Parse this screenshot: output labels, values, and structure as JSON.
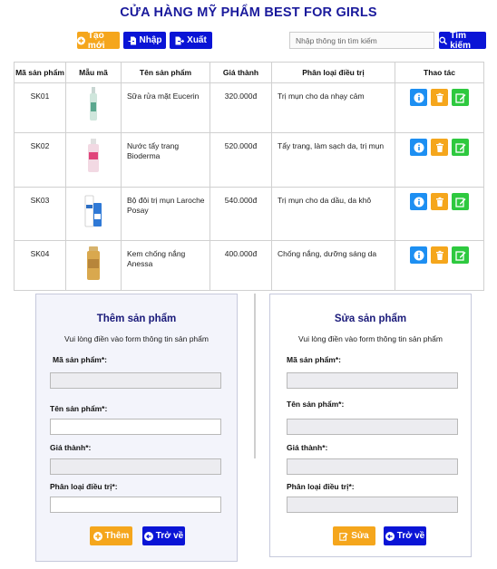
{
  "header": {
    "title": "CỬA HÀNG MỸ PHẨM BEST FOR GIRLS"
  },
  "toolbar": {
    "create_label": "Tạo mới",
    "import_label": "Nhập",
    "export_label": "Xuất",
    "search_placeholder": "Nhập thông tin tìm kiếm",
    "search_label": "Tìm kiếm"
  },
  "table": {
    "headers": [
      "Mã sản phẩm",
      "Mẫu mã",
      "Tên sản phẩm",
      "Giá thành",
      "Phân loại điều trị",
      "Thao tác"
    ],
    "rows": [
      {
        "code": "SK01",
        "name": "Sữa rửa mặt Eucerin",
        "price": "320.000đ",
        "type": "Trị mụn cho da nhạy cảm"
      },
      {
        "code": "SK02",
        "name": "Nước tẩy trang Bioderma",
        "price": "520.000đ",
        "type": "Tẩy trang, làm sạch da, trị mụn"
      },
      {
        "code": "SK03",
        "name": "Bộ đôi trị mụn Laroche Posay",
        "price": "540.000đ",
        "type": "Trị mụn cho da dầu, da khô"
      },
      {
        "code": "SK04",
        "name": "Kem chống nắng Anessa",
        "price": "400.000đ",
        "type": "Chống nắng, dưỡng sáng da"
      }
    ]
  },
  "add_form": {
    "title": "Thêm sản phẩm",
    "subtitle": "Vui lòng điền vào form thông tin sản phẩm",
    "code_label": "Mã sản phẩm*:",
    "name_label": "Tên sản phẩm*:",
    "price_label": "Giá thành*:",
    "type_label": "Phân loại điều trị*:",
    "submit_label": "Thêm",
    "back_label": "Trở về"
  },
  "edit_form": {
    "title": "Sửa sản phẩm",
    "subtitle": "Vui lòng điền vào form thông tin sản phẩm",
    "code_label": "Mã sản phẩm*:",
    "name_label": "Tên sản phẩm*:",
    "price_label": "Giá thành*:",
    "type_label": "Phân loại điều trị*:",
    "submit_label": "Sửa",
    "back_label": "Trở về"
  },
  "colors": {
    "title": "#1a1a9c",
    "orange": "#f5a61c",
    "blue": "#0a14d6",
    "info": "#1d8ff2",
    "edit": "#2ec93f",
    "panel_bg": "#f3f4fb"
  },
  "icons": {
    "create": "plus-circle-icon",
    "import": "file-import-icon",
    "export": "file-export-icon",
    "search": "search-icon",
    "info": "info-icon",
    "delete": "trash-icon",
    "edit": "edit-icon",
    "back": "arrow-left-circle-icon"
  }
}
